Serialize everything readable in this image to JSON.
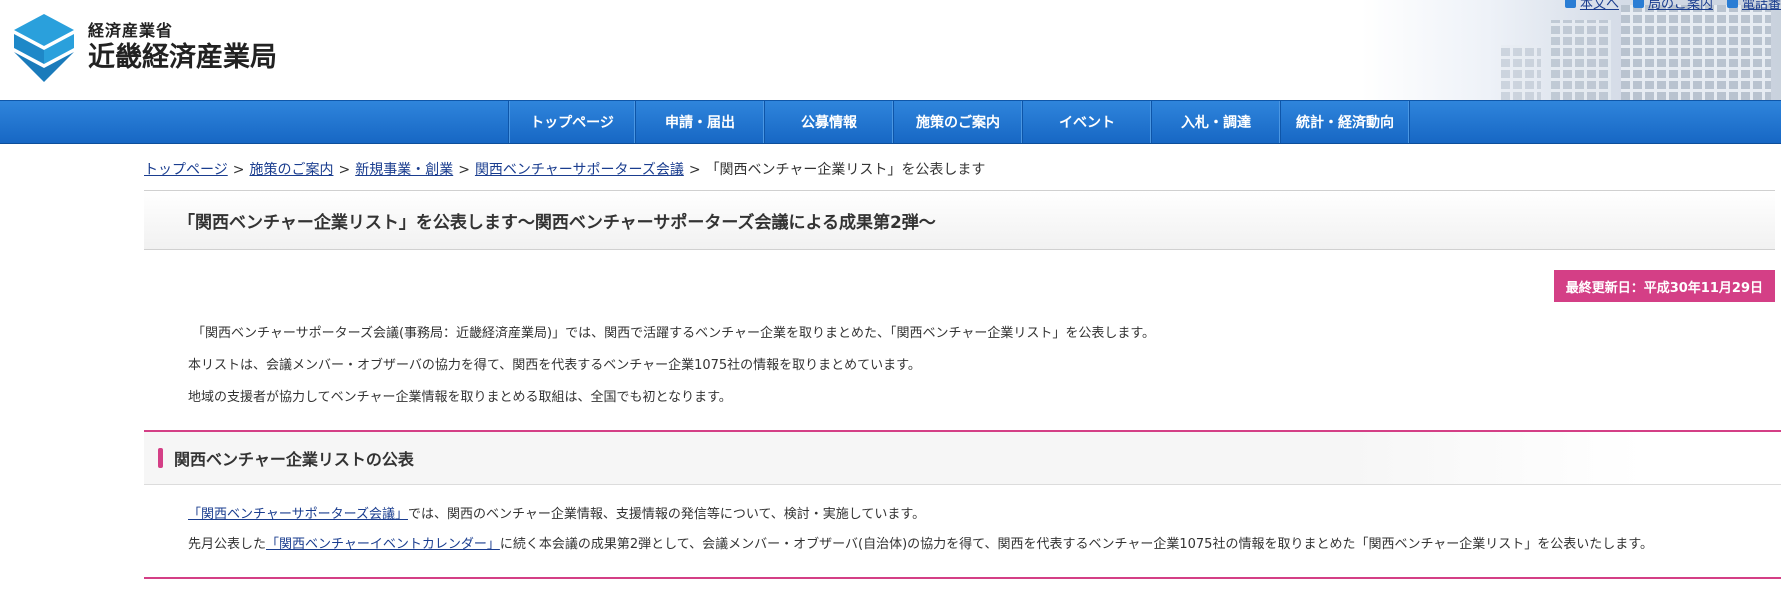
{
  "header": {
    "logo_sub": "経済産業省",
    "logo_main": "近畿経済産業局",
    "top_links": [
      "本文へ",
      "局のご案内",
      "電話番"
    ]
  },
  "nav": {
    "items": [
      "トップページ",
      "申請・届出",
      "公募情報",
      "施策のご案内",
      "イベント",
      "入札・調達",
      "統計・経済動向"
    ]
  },
  "breadcrumb": {
    "items": [
      "トップページ",
      "施策のご案内",
      "新規事業・創業",
      "関西ベンチャーサポーターズ会議"
    ],
    "current": "「関西ベンチャー企業リスト」を公表します",
    "separator": ">"
  },
  "page": {
    "title": "「関西ベンチャー企業リスト」を公表します〜関西ベンチャーサポーターズ会議による成果第2弾〜",
    "updated": "最終更新日：平成30年11月29日",
    "intro": [
      "「関西ベンチャーサポーターズ会議(事務局：近畿経済産業局)」では、関西で活躍するベンチャー企業を取りまとめた、「関西ベンチャー企業リスト」を公表します。",
      "本リストは、会議メンバー・オブザーバの協力を得て、関西を代表するベンチャー企業1075社の情報を取りまとめています。",
      "地域の支援者が協力してベンチャー企業情報を取りまとめる取組は、全国でも初となります。"
    ],
    "section_title": "関西ベンチャー企業リストの公表",
    "section_p1_link": "「関西ベンチャーサポーターズ会議」",
    "section_p1_text": "では、関西のベンチャー企業情報、支援情報の発信等について、検討・実施しています。",
    "section_p2_pre": "先月公表した",
    "section_p2_link": "「関西ベンチャーイベントカレンダー」",
    "section_p2_text": "に続く本会議の成果第2弾として、会議メンバー・オブザーバ(自治体)の協力を得て、関西を代表するベンチャー企業1075社の情報を取りまとめた「関西ベンチャー企業リスト」を公表いたします。"
  },
  "colors": {
    "nav_blue": "#1f74d0",
    "accent_pink": "#d43f86",
    "link": "#1a3d8f"
  }
}
